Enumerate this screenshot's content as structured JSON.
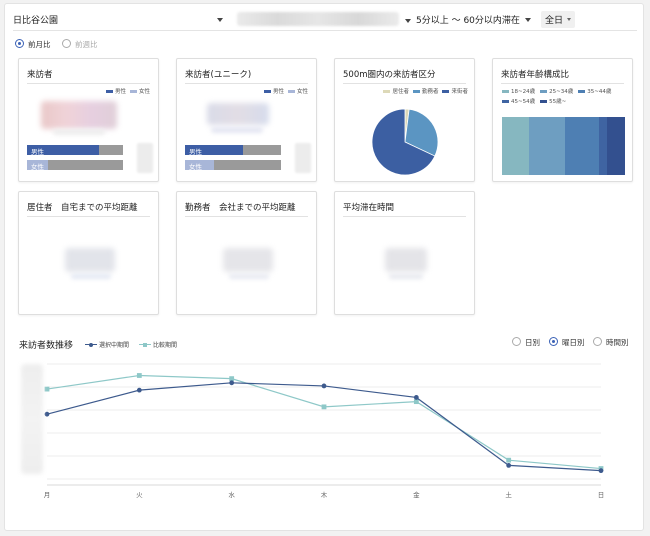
{
  "filters": {
    "park": "日比谷公園",
    "stay_range": "5分以上 〜 60分以内滞在",
    "time_of_day": "全日"
  },
  "compare": {
    "options": [
      {
        "label": "前月比",
        "selected": true
      },
      {
        "label": "前週比",
        "selected": false
      }
    ]
  },
  "colors": {
    "male": "#3d5ea5",
    "female": "#a8b6d8",
    "resident": "#ddd9b8",
    "worker": "#5b95c2",
    "visitor": "#3c5fa2",
    "selected_series": "#3d5a8d",
    "compare_series": "#8ec8c8"
  },
  "cards": {
    "visitors": {
      "title": "来訪者",
      "legend": [
        "男性",
        "女性"
      ],
      "bars": [
        {
          "label": "男性",
          "share": 0.75
        },
        {
          "label": "女性",
          "share": 0.22
        }
      ]
    },
    "unique": {
      "title": "来訪者(ユニーク)",
      "legend": [
        "男性",
        "女性"
      ],
      "bars": [
        {
          "label": "男性",
          "share": 0.6
        },
        {
          "label": "女性",
          "share": 0.3
        }
      ]
    },
    "area500": {
      "title": "500m圏内の来訪者区分",
      "legend": [
        "居住者",
        "勤務者",
        "来街者"
      ],
      "pie": [
        {
          "name": "居住者",
          "value": 2
        },
        {
          "name": "勤務者",
          "value": 30
        },
        {
          "name": "来街者",
          "value": 68
        }
      ]
    },
    "age": {
      "title": "来訪者年齢構成比",
      "legend": [
        "18~24歳",
        "25~34歳",
        "35~44歳",
        "45~54歳",
        "55歳~"
      ],
      "segments": [
        {
          "name": "18~24歳",
          "share": 0.22,
          "color": "#86b7c0"
        },
        {
          "name": "25~34歳",
          "share": 0.29,
          "color": "#6e9ec1"
        },
        {
          "name": "35~44歳",
          "share": 0.28,
          "color": "#4e7fb3"
        },
        {
          "name": "45~54歳",
          "share": 0.06,
          "color": "#3f64a2"
        },
        {
          "name": "55歳~",
          "share": 0.15,
          "color": "#33508f"
        }
      ]
    },
    "resident_distance": {
      "title": "居住者　自宅までの平均距離"
    },
    "worker_distance": {
      "title": "勤務者　会社までの平均距離"
    },
    "avg_stay": {
      "title": "平均滞在時間"
    }
  },
  "trend": {
    "title": "来訪者数推移",
    "legend": [
      "選択中期間",
      "比較期間"
    ],
    "granularity": [
      {
        "label": "日別",
        "selected": false
      },
      {
        "label": "曜日別",
        "selected": true
      },
      {
        "label": "時間別",
        "selected": false
      }
    ]
  },
  "chart_data": {
    "type": "line",
    "categories": [
      "月",
      "火",
      "水",
      "木",
      "金",
      "土",
      "日"
    ],
    "series": [
      {
        "name": "選択中期間",
        "values": [
          62,
          85,
          92,
          89,
          78,
          13,
          8
        ]
      },
      {
        "name": "比較期間",
        "values": [
          86,
          99,
          96,
          69,
          74,
          18,
          10
        ]
      }
    ],
    "ylim": [
      0,
      110
    ],
    "grid": true
  }
}
